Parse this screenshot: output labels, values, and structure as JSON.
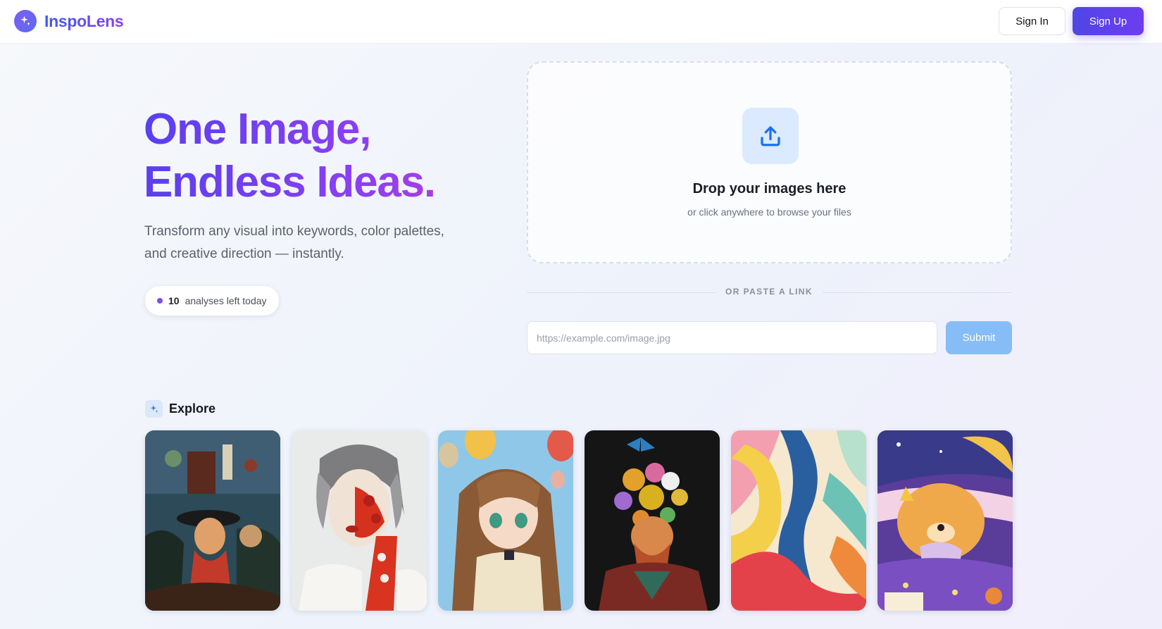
{
  "header": {
    "brand": "InspoLens",
    "sign_in": "Sign In",
    "sign_up": "Sign Up"
  },
  "hero": {
    "title_line1": "One Image,",
    "title_line2": "Endless Ideas.",
    "subtitle": "Transform any visual into keywords, color palettes, and creative direction — instantly.",
    "quota_count": "10",
    "quota_label": "analyses left today"
  },
  "upload": {
    "title": "Drop your images here",
    "subtitle": "or click anywhere to browse your files",
    "divider": "OR PASTE A LINK",
    "placeholder": "https://example.com/image.jpg",
    "submit": "Submit"
  },
  "explore": {
    "title": "Explore",
    "images": [
      {
        "name": "expressionist-cafe-painting"
      },
      {
        "name": "ink-portrait-red-florals"
      },
      {
        "name": "anime-girl-balloons"
      },
      {
        "name": "floral-head-portrait"
      },
      {
        "name": "watercolor-abstract-ribbons"
      },
      {
        "name": "cozy-puppy-illustration"
      }
    ]
  },
  "colors": {
    "brand_primary": "#4f46e5",
    "brand_purple": "#8b3ff2",
    "submit_disabled": "#86bdf7",
    "upload_icon_bg": "#dbeafe"
  }
}
